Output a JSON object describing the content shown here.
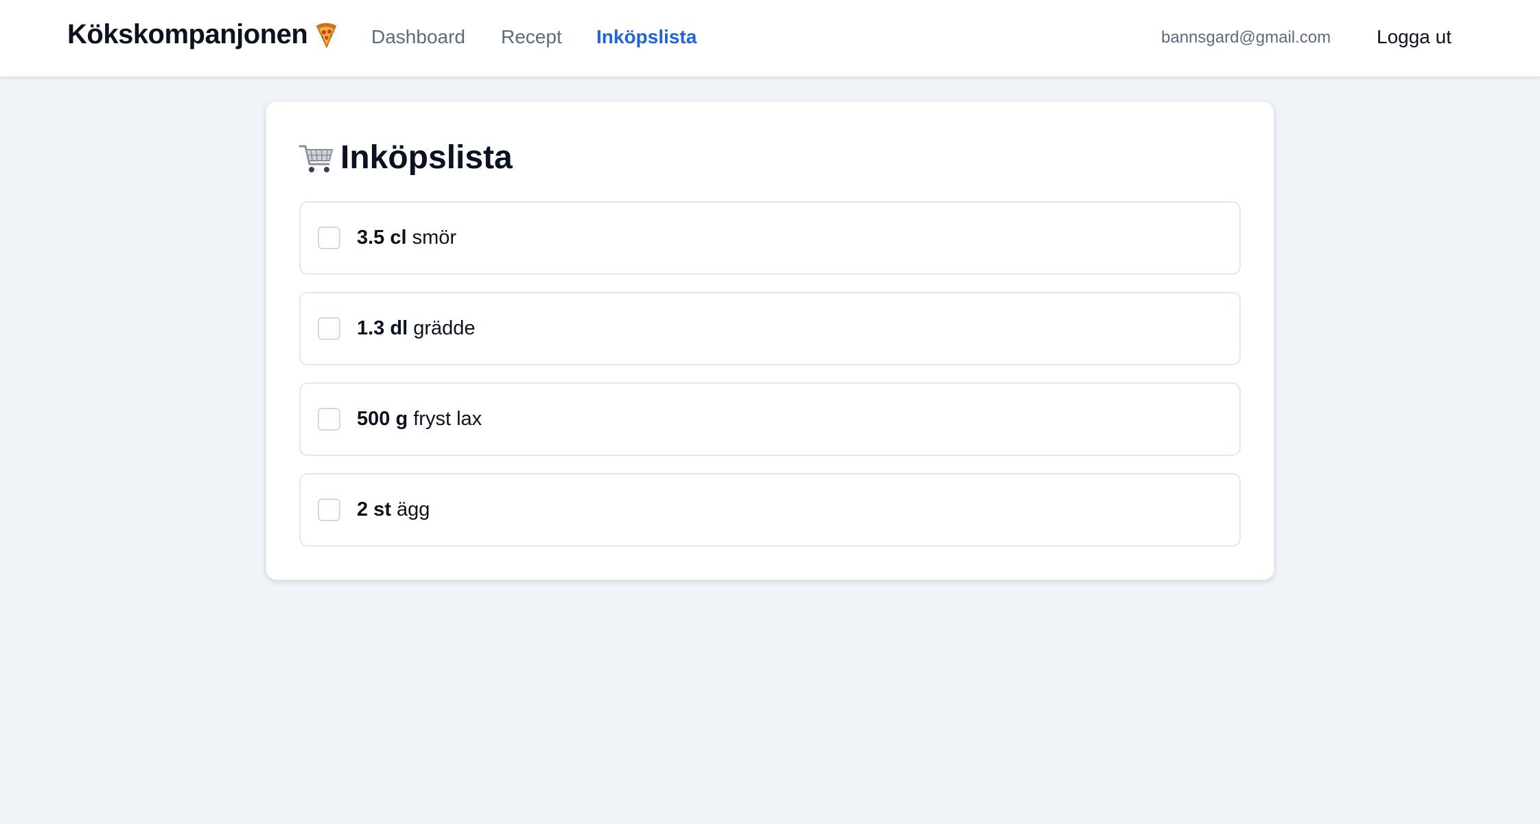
{
  "app": {
    "brand": "Kökskompanjonen"
  },
  "nav": {
    "links": [
      {
        "label": "Dashboard"
      },
      {
        "label": "Recept"
      },
      {
        "label": "Inköpslista"
      }
    ]
  },
  "user": {
    "email": "bannsgard@gmail.com",
    "logout_label": "Logga ut"
  },
  "page": {
    "title": "Inköpslista"
  },
  "shopping_list": {
    "items": [
      {
        "quantity": "3.5 cl",
        "name": "smör",
        "checked": false
      },
      {
        "quantity": "1.3 dl",
        "name": "grädde",
        "checked": false
      },
      {
        "quantity": "500 g",
        "name": "fryst lax",
        "checked": false
      },
      {
        "quantity": "2 st",
        "name": "ägg",
        "checked": false
      }
    ]
  },
  "colors": {
    "accent": "#1f63e0",
    "background": "#f0f3f8",
    "nav_text": "#5b6b82"
  },
  "icons": {
    "brand_icon": "pizza-icon",
    "title_icon": "shopping-cart-icon"
  }
}
